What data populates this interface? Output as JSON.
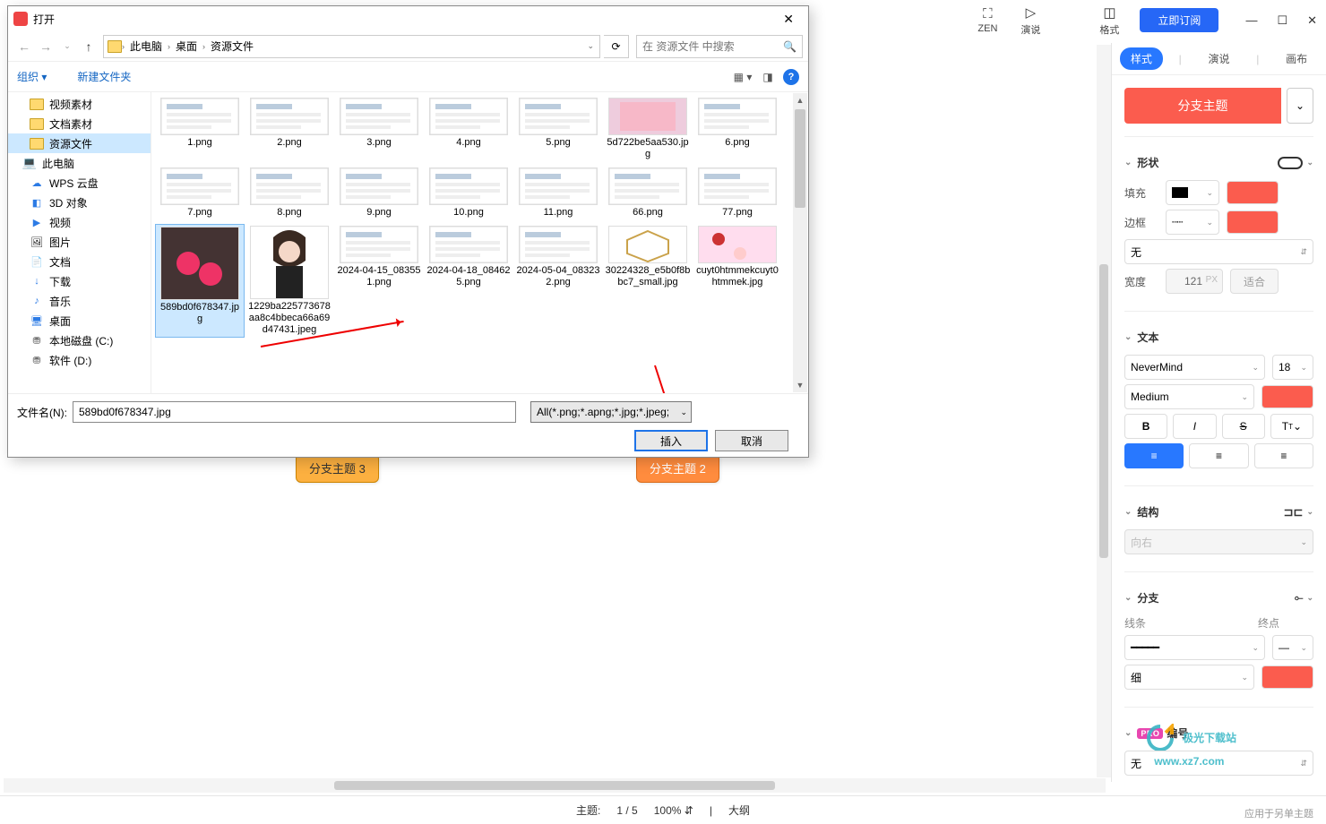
{
  "toolbar": {
    "zen": {
      "label": "ZEN"
    },
    "present": {
      "label": "演说"
    },
    "format": {
      "label": "格式"
    },
    "subscribe": "立即订阅"
  },
  "panel": {
    "tabs": {
      "style": "样式",
      "present": "演说",
      "canvas": "画布"
    },
    "branch_btn": "分支主题",
    "sections": {
      "shape": {
        "title": "形状",
        "fill": "填充",
        "border": "边框",
        "none": "无",
        "width_lbl": "宽度",
        "width_val": "121",
        "width_unit": "PX",
        "fit": "适合"
      },
      "text": {
        "title": "文本",
        "font": "NeverMind",
        "size": "18",
        "weight": "Medium"
      },
      "struct": {
        "title": "结构",
        "dir": "向右"
      },
      "branch": {
        "title": "分支",
        "line": "线条",
        "end": "终点",
        "thin": "细"
      },
      "number": {
        "title": "编号",
        "pro": "PRO",
        "none": "无"
      }
    }
  },
  "canvas": {
    "node1": "分支主题 3",
    "node2": "分支主题 2"
  },
  "status": {
    "theme": "主题:",
    "theme_v": "1 / 5",
    "zoom": "100%",
    "outline": "大纲",
    "apply": "应用于另单主题"
  },
  "watermark": {
    "line1": "极光下载站",
    "line2": "www.xz7.com"
  },
  "dialog": {
    "title": "打开",
    "crumbs": [
      "此电脑",
      "桌面",
      "资源文件"
    ],
    "address_tail": "",
    "search_placeholder": "在 资源文件 中搜索",
    "org": "组织",
    "newfolder": "新建文件夹",
    "tree": [
      {
        "label": "视频素材",
        "icon": "folder"
      },
      {
        "label": "文档素材",
        "icon": "folder"
      },
      {
        "label": "资源文件",
        "icon": "folder",
        "active": true
      },
      {
        "label": "此电脑",
        "icon": "pc",
        "indent": 16
      },
      {
        "label": "WPS 云盘",
        "icon": "wps"
      },
      {
        "label": "3D 对象",
        "icon": "d3"
      },
      {
        "label": "视频",
        "icon": "vid"
      },
      {
        "label": "图片",
        "icon": "pic"
      },
      {
        "label": "文档",
        "icon": "doc"
      },
      {
        "label": "下载",
        "icon": "dl"
      },
      {
        "label": "音乐",
        "icon": "music"
      },
      {
        "label": "桌面",
        "icon": "desk"
      },
      {
        "label": "本地磁盘 (C:)",
        "icon": "disk"
      },
      {
        "label": "软件 (D:)",
        "icon": "disk"
      }
    ],
    "files_r1": [
      {
        "name": "1.png"
      },
      {
        "name": "2.png"
      },
      {
        "name": "3.png"
      },
      {
        "name": "4.png"
      },
      {
        "name": "5.png"
      },
      {
        "name": "5d722be5aa530.jpg"
      },
      {
        "name": "6.png"
      }
    ],
    "files_r2": [
      {
        "name": "7.png"
      },
      {
        "name": "8.png"
      },
      {
        "name": "9.png"
      },
      {
        "name": "10.png"
      },
      {
        "name": "11.png"
      },
      {
        "name": "66.png"
      },
      {
        "name": "77.png"
      }
    ],
    "files_r3": [
      {
        "name": "589bd0f678347.jpg",
        "selected": true
      },
      {
        "name": "1229ba225773678aa8c4bbeca66a69d47431.jpeg"
      },
      {
        "name": "2024-04-15_083551.png"
      },
      {
        "name": "2024-04-18_084625.png"
      },
      {
        "name": "2024-05-04_083232.png"
      },
      {
        "name": "30224328_e5b0f8bbc7_small.jpg"
      },
      {
        "name": "cuyt0htmmekcuyt0htmmek.jpg"
      }
    ],
    "fn_label": "文件名(N):",
    "fn_value": "589bd0f678347.jpg",
    "type_filter": "All(*.png;*.apng;*.jpg;*.jpeg;",
    "insert": "插入",
    "cancel": "取消"
  }
}
